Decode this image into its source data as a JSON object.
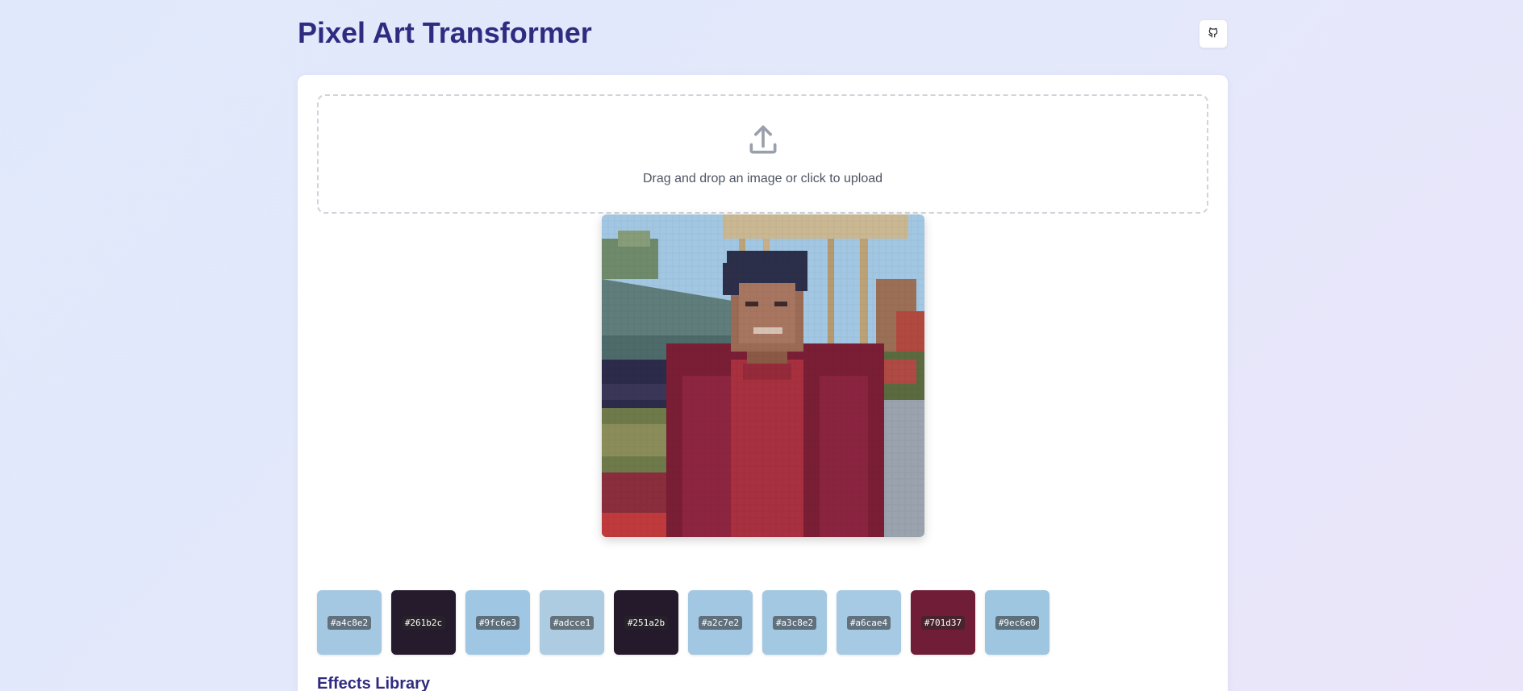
{
  "header": {
    "title": "Pixel Art Transformer",
    "github_icon": "github-icon"
  },
  "upload": {
    "icon": "upload-icon",
    "prompt": "Drag and drop an image or click to upload"
  },
  "preview": {
    "description_icon": "pixelated-photo"
  },
  "palette": [
    {
      "hex": "#a4c8e2",
      "label": "#a4c8e2"
    },
    {
      "hex": "#261b2c",
      "label": "#261b2c"
    },
    {
      "hex": "#9fc6e3",
      "label": "#9fc6e3"
    },
    {
      "hex": "#adcce1",
      "label": "#adcce1"
    },
    {
      "hex": "#251a2b",
      "label": "#251a2b"
    },
    {
      "hex": "#a2c7e2",
      "label": "#a2c7e2"
    },
    {
      "hex": "#a3c8e2",
      "label": "#a3c8e2"
    },
    {
      "hex": "#a6cae4",
      "label": "#a6cae4"
    },
    {
      "hex": "#701d37",
      "label": "#701d37"
    },
    {
      "hex": "#9ec6e0",
      "label": "#9ec6e0"
    }
  ],
  "effects": {
    "heading": "Effects Library"
  },
  "colors": {
    "title": "#2f2b80",
    "card": "#ffffff",
    "dropzone_border": "#cfd3da"
  }
}
